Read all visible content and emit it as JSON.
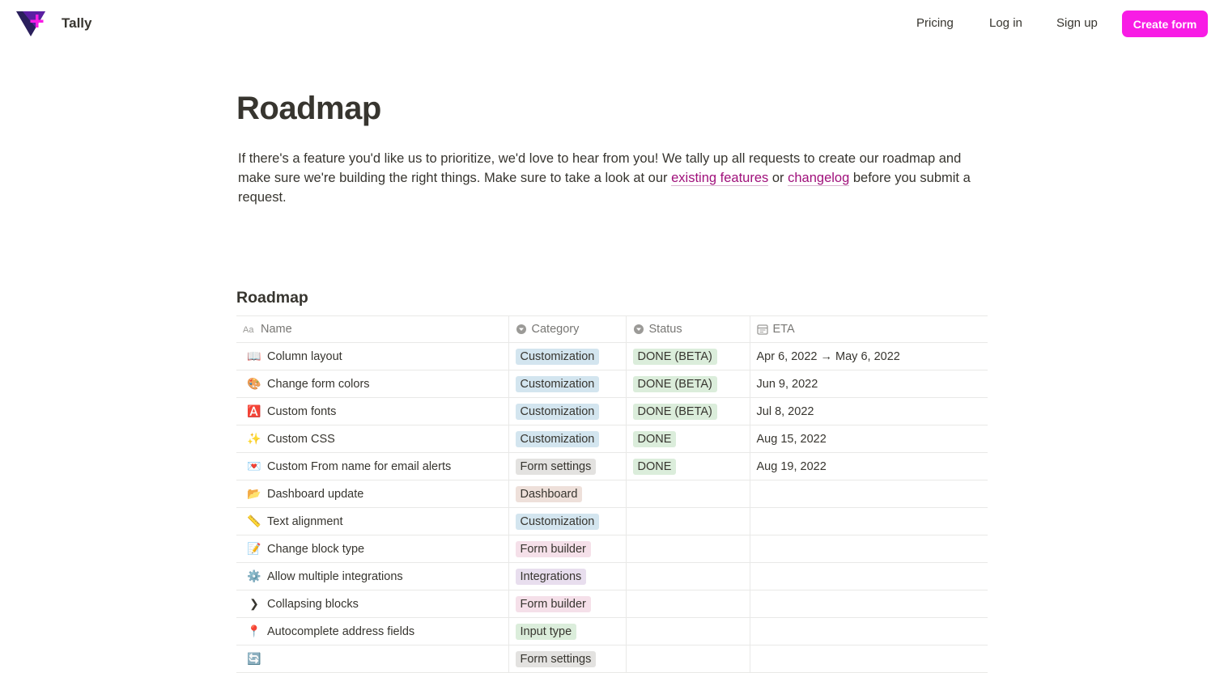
{
  "brand": {
    "name": "Tally",
    "logo_icon": "tally-logo",
    "accent": "#f81ce5"
  },
  "nav": {
    "pricing": "Pricing",
    "login": "Log in",
    "signup": "Sign up",
    "cta": "Create form"
  },
  "page": {
    "title": "Roadmap",
    "intro_part1": "If there's a feature you'd like us to prioritize, we'd love to hear from you! We tally up all requests to create our roadmap and make sure we're building the right things. Make sure to take a look at our ",
    "link_features": "existing features",
    "intro_or": " or ",
    "link_changelog": "changelog",
    "intro_part2": " before you submit a request."
  },
  "roadmap": {
    "title": "Roadmap",
    "columns": [
      {
        "label": "Name",
        "icon": "text-property-icon"
      },
      {
        "label": "Category",
        "icon": "select-property-icon"
      },
      {
        "label": "Status",
        "icon": "select-property-icon"
      },
      {
        "label": "ETA",
        "icon": "calendar-icon"
      }
    ],
    "rows": [
      {
        "emoji": "📖",
        "name": "Column layout",
        "category": "Customization",
        "cat_color": "blue",
        "status": "DONE (BETA)",
        "eta": "Apr 6, 2022 → May 6, 2022"
      },
      {
        "emoji": "🎨",
        "name": "Change form colors",
        "category": "Customization",
        "cat_color": "blue",
        "status": "DONE (BETA)",
        "eta": "Jun 9, 2022"
      },
      {
        "emoji": "🅰️",
        "name": "Custom fonts",
        "category": "Customization",
        "cat_color": "blue",
        "status": "DONE (BETA)",
        "eta": "Jul 8, 2022"
      },
      {
        "emoji": "✨",
        "name": "Custom CSS",
        "category": "Customization",
        "cat_color": "blue",
        "status": "DONE",
        "eta": "Aug 15, 2022"
      },
      {
        "emoji": "💌",
        "name": "Custom From name for email alerts",
        "category": "Form settings",
        "cat_color": "gray",
        "status": "DONE",
        "eta": "Aug 19, 2022"
      },
      {
        "emoji": "📂",
        "name": "Dashboard update",
        "category": "Dashboard",
        "cat_color": "brown",
        "status": "",
        "eta": ""
      },
      {
        "emoji": "📏",
        "name": "Text alignment",
        "category": "Customization",
        "cat_color": "blue",
        "status": "",
        "eta": ""
      },
      {
        "emoji": "📝",
        "name": "Change block type",
        "category": "Form builder",
        "cat_color": "pink",
        "status": "",
        "eta": ""
      },
      {
        "emoji": "⚙️",
        "name": "Allow multiple integrations",
        "category": "Integrations",
        "cat_color": "purple",
        "status": "",
        "eta": ""
      },
      {
        "emoji": "❯",
        "name": "Collapsing blocks",
        "category": "Form builder",
        "cat_color": "pink",
        "status": "",
        "eta": ""
      },
      {
        "emoji": "📍",
        "name": "Autocomplete address fields",
        "category": "Input type",
        "cat_color": "green",
        "status": "",
        "eta": ""
      },
      {
        "emoji": "🔄",
        "name": "",
        "category": "Form settings",
        "cat_color": "gray",
        "status": "",
        "eta": ""
      }
    ]
  }
}
